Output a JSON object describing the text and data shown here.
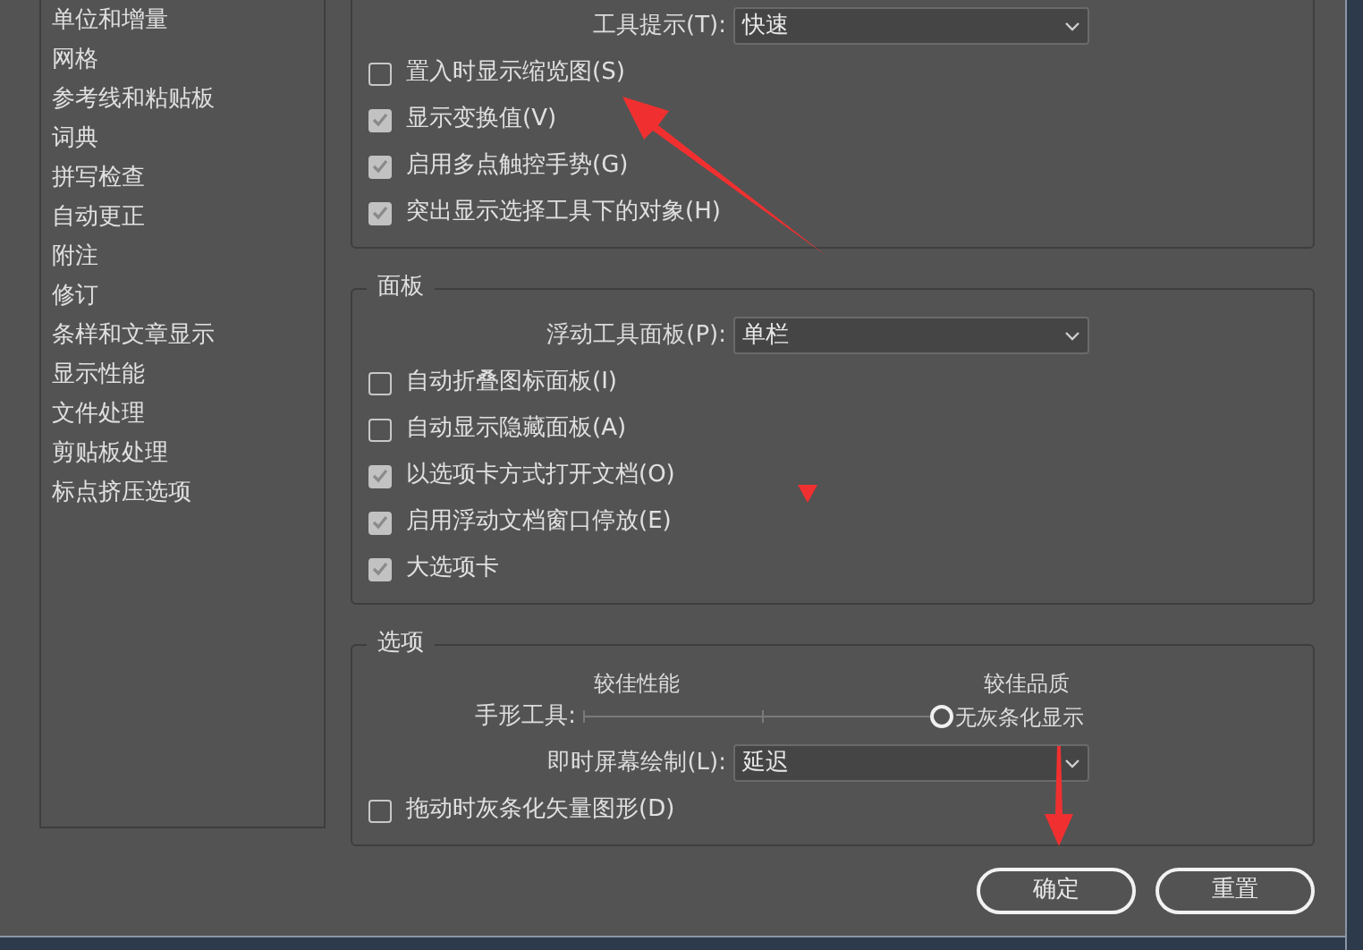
{
  "sidebar": {
    "items": [
      {
        "label": "单位和增量"
      },
      {
        "label": "网格"
      },
      {
        "label": "参考线和粘贴板"
      },
      {
        "label": "词典"
      },
      {
        "label": "拼写检查"
      },
      {
        "label": "自动更正"
      },
      {
        "label": "附注"
      },
      {
        "label": "修订"
      },
      {
        "label": "条样和文章显示"
      },
      {
        "label": "显示性能"
      },
      {
        "label": "文件处理"
      },
      {
        "label": "剪贴板处理"
      },
      {
        "label": "标点挤压选项"
      }
    ]
  },
  "sections": [
    {
      "items": [
        {
          "kind": "dropdown",
          "label": "工具提示(T):",
          "value": "快速"
        },
        {
          "kind": "checkbox",
          "label": "置入时显示缩览图(S)",
          "checked": false
        },
        {
          "kind": "checkbox",
          "label": "显示变换值(V)",
          "checked": true
        },
        {
          "kind": "checkbox",
          "label": "启用多点触控手势(G)",
          "checked": true
        },
        {
          "kind": "checkbox",
          "label": "突出显示选择工具下的对象(H)",
          "checked": true
        }
      ]
    },
    {
      "title": "面板",
      "items": [
        {
          "kind": "dropdown",
          "label": "浮动工具面板(P):",
          "value": "单栏"
        },
        {
          "kind": "checkbox",
          "label": "自动折叠图标面板(I)",
          "checked": false
        },
        {
          "kind": "checkbox",
          "label": "自动显示隐藏面板(A)",
          "checked": false
        },
        {
          "kind": "checkbox",
          "label": "以选项卡方式打开文档(O)",
          "checked": true
        },
        {
          "kind": "checkbox",
          "label": "启用浮动文档窗口停放(E)",
          "checked": true
        },
        {
          "kind": "checkbox",
          "label": "大选项卡",
          "checked": true
        }
      ]
    },
    {
      "title": "选项",
      "items": [
        {
          "kind": "slider",
          "label": "手形工具:",
          "left_caption": "较佳性能",
          "right_caption": "较佳品质",
          "reading": "无灰条化显示",
          "level": 1
        },
        {
          "kind": "dropdown",
          "label": "即时屏幕绘制(L):",
          "value": "延迟"
        },
        {
          "kind": "checkbox",
          "label": "拖动时灰条化矢量图形(D)",
          "checked": false
        }
      ]
    }
  ],
  "buttons": [
    {
      "label": "确定"
    },
    {
      "label": "重置"
    }
  ]
}
